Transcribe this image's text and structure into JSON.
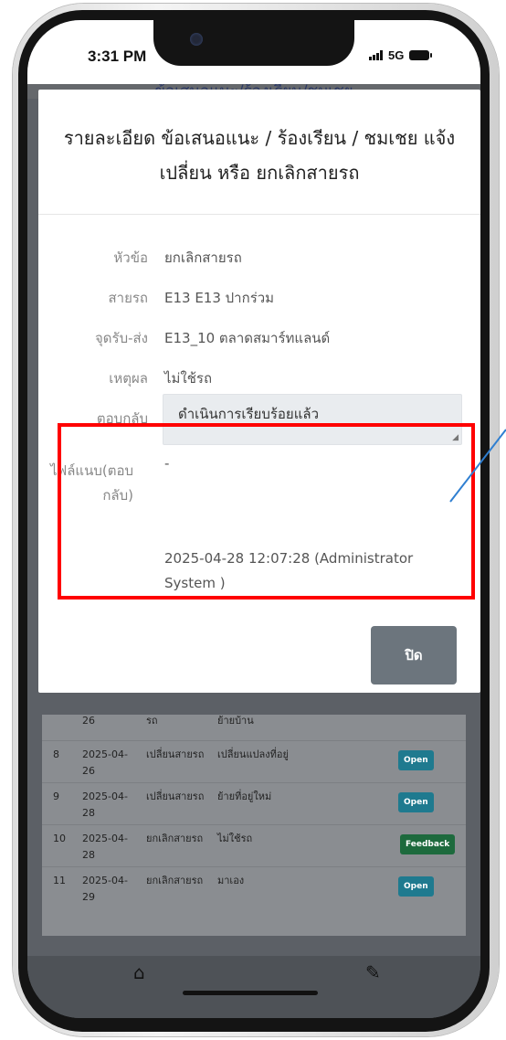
{
  "status_bar": {
    "time": "3:31 PM",
    "network": "5G"
  },
  "background_page": {
    "header_title": "ข้อเสนอแนะ/ร้องเรียน/ชมเชย",
    "table_rows": [
      {
        "no": "",
        "date": "26",
        "type": "รถ",
        "reason": "ย้ายบ้าน",
        "status": ""
      },
      {
        "no": "8",
        "date": "2025-04-26",
        "type": "เปลี่ยนสายรถ",
        "reason": "เปลี่ยนแปลงที่อยู่",
        "status": "Open"
      },
      {
        "no": "9",
        "date": "2025-04-28",
        "type": "เปลี่ยนสายรถ",
        "reason": "ย้ายที่อยู่ใหม่",
        "status": "Open"
      },
      {
        "no": "10",
        "date": "2025-04-28",
        "type": "ยกเลิกสายรถ",
        "reason": "ไม่ใช้รถ",
        "status": "Feedback"
      },
      {
        "no": "11",
        "date": "2025-04-29",
        "type": "ยกเลิกสายรถ",
        "reason": "มาเอง",
        "status": "Open"
      }
    ]
  },
  "modal": {
    "title": "รายละเอียด ข้อเสนอแนะ / ร้องเรียน / ชมเชย แจ้งเปลี่ยน หรือ ยกเลิกสายรถ",
    "fields": {
      "topic_label": "หัวข้อ",
      "topic_value": "ยกเลิกสายรถ",
      "route_label": "สายรถ",
      "route_value": "E13 E13 ปากร่วม",
      "stop_label": "จุดรับ-ส่ง",
      "stop_value": "E13_10 ตลาดสมาร์ทแลนด์",
      "reason_label": "เหตุผล",
      "reason_value": "ไม่ใช้รถ",
      "reply_label": "ตอบกลับ",
      "reply_value": "ดำเนินการเรียบร้อยแล้ว",
      "attachment_label": "ไฟล์แนบ(ตอบกลับ)",
      "attachment_value": "-",
      "reply_meta": "2025-04-28 12:07:28 (Administrator System )"
    },
    "close_label": "ปิด"
  },
  "nav": {
    "home_icon": "home-icon",
    "edit_icon": "edit-icon"
  },
  "colors": {
    "highlight": "#ff0000",
    "annotation_line": "#2f7fd1",
    "close_button": "#6c757d"
  }
}
